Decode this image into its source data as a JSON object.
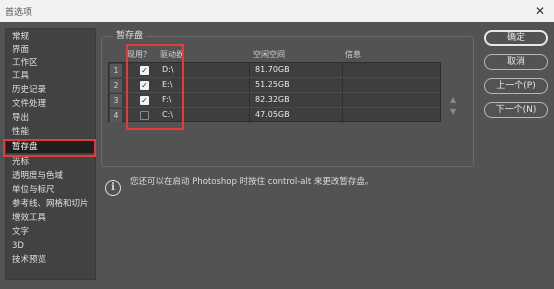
{
  "window": {
    "title": "首选项",
    "close_glyph": "✕"
  },
  "sidebar": {
    "items": [
      {
        "label": "常规"
      },
      {
        "label": "界面"
      },
      {
        "label": "工作区"
      },
      {
        "label": "工具"
      },
      {
        "label": "历史记录"
      },
      {
        "label": "文件处理"
      },
      {
        "label": "导出"
      },
      {
        "label": "性能"
      },
      {
        "label": "暂存盘",
        "selected": true
      },
      {
        "label": "光标"
      },
      {
        "label": "透明度与色域"
      },
      {
        "label": "单位与标尺"
      },
      {
        "label": "参考线、网格和切片"
      },
      {
        "label": "增效工具"
      },
      {
        "label": "文字"
      },
      {
        "label": "3D"
      },
      {
        "label": "技术预览"
      }
    ]
  },
  "scratch": {
    "title": "暂存盘",
    "columns": [
      "现用？",
      "驱动器",
      "空闲空间",
      "信息"
    ],
    "rows": [
      {
        "num": "1",
        "active": true,
        "drive": "D:\\",
        "space": "81.70GB",
        "info": ""
      },
      {
        "num": "2",
        "active": true,
        "drive": "E:\\",
        "space": "51.25GB",
        "info": ""
      },
      {
        "num": "3",
        "active": true,
        "drive": "F:\\",
        "space": "82.32GB",
        "info": ""
      },
      {
        "num": "4",
        "active": false,
        "drive": "C:\\",
        "space": "47.05GB",
        "info": ""
      }
    ],
    "move_up_glyph": "▲",
    "move_down_glyph": "▼"
  },
  "info": {
    "icon": "info-icon",
    "text": "您还可以在启动 Photoshop 时按住 control-alt 来更改暂存盘。"
  },
  "buttons": {
    "ok": "确定",
    "cancel": "取消",
    "prev": "上一个(P)",
    "next": "下一个(N)"
  },
  "colors": {
    "highlight": "#e43a3a",
    "background": "#535353",
    "selected_item": "#1f1f1f"
  }
}
